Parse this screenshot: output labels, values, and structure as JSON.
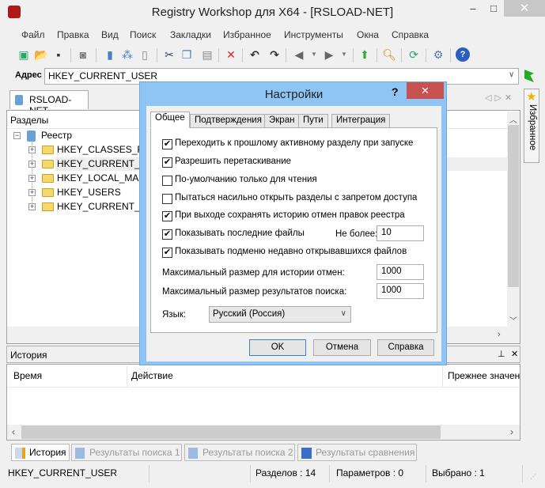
{
  "window": {
    "title": "Registry Workshop для X64 - [RSLOAD-NET]",
    "minimize": "–",
    "maximize": "□",
    "close": "✕"
  },
  "menu": [
    "Файл",
    "Правка",
    "Вид",
    "Поиск",
    "Закладки",
    "Избранное",
    "Инструменты",
    "Окна",
    "Справка"
  ],
  "toolbar": [
    "new-icon",
    "open-icon",
    "save-icon",
    "snapshot-icon",
    "computer-icon",
    "network-icon",
    "usb-icon",
    "cut-icon",
    "copy-icon",
    "paste-icon",
    "delete-icon",
    "undo-icon",
    "redo-icon",
    "back-icon",
    "forward-icon",
    "up-icon",
    "find-icon",
    "refresh-icon",
    "settings-icon",
    "help-icon"
  ],
  "address": {
    "label": "Адрес",
    "value": "HKEY_CURRENT_USER"
  },
  "doc_tab": "RSLOAD-NET",
  "favorites_tab": "Избранное",
  "tree": {
    "header": "Разделы",
    "root": "Реестр",
    "items": [
      "HKEY_CLASSES_ROOT",
      "HKEY_CURRENT_USER",
      "HKEY_LOCAL_MACHINE",
      "HKEY_USERS",
      "HKEY_CURRENT_CONFIG"
    ]
  },
  "history": {
    "title": "История",
    "columns": [
      "Время",
      "Действие",
      "Прежнее значен"
    ]
  },
  "bottom_tabs": [
    "История",
    "Результаты поиска 1",
    "Результаты поиска 2",
    "Результаты сравнения"
  ],
  "status": {
    "path": "HKEY_CURRENT_USER",
    "keys": "Разделов : 14",
    "values": "Параметров : 0",
    "selected": "Выбрано : 1"
  },
  "dialog": {
    "title": "Настройки",
    "help": "?",
    "close": "✕",
    "tabs": [
      "Общее",
      "Подтверждения",
      "Экран",
      "Пути",
      "Интеграция"
    ],
    "checkboxes": [
      {
        "label": "Переходить к прошлому активному разделу при запуске",
        "checked": true
      },
      {
        "label": "Разрешить перетаскивание",
        "checked": true
      },
      {
        "label": "По-умолчанию только для чтения",
        "checked": false
      },
      {
        "label": "Пытаться насильно открыть разделы с запретом доступа",
        "checked": false
      },
      {
        "label": "При выходе сохранять историю отмен правок реестра",
        "checked": true
      },
      {
        "label": "Показывать последние файлы",
        "checked": true
      },
      {
        "label": "Показывать подменю недавно открывавшихся файлов",
        "checked": true
      }
    ],
    "recent_max_label": "Не более:",
    "recent_max": "10",
    "undo_label": "Максимальный размер для истории отмен:",
    "undo_value": "1000",
    "search_label": "Максимальный размер результатов поиска:",
    "search_value": "1000",
    "lang_label": "Язык:",
    "lang_value": "Русский (Россия)",
    "ok": "OK",
    "cancel": "Отмена",
    "help_btn": "Справка"
  }
}
